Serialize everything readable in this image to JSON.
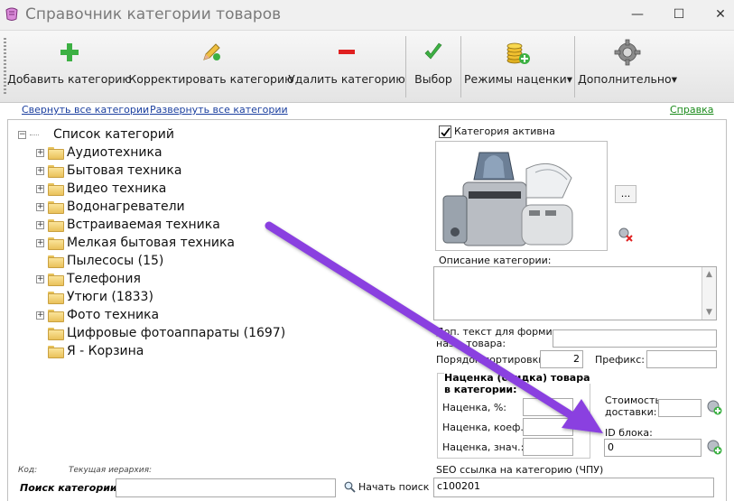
{
  "window": {
    "title": "Справочник категории товаров",
    "minimize_glyph": "—",
    "maximize_glyph": "☐",
    "close_glyph": "✕"
  },
  "toolbar": {
    "add_label": "Добавить категорию",
    "edit_label": "Корректировать категорию",
    "delete_label": "Удалить категорию",
    "select_label": "Выбор",
    "markup_modes_label": "Режимы наценки",
    "more_label": "Дополнительно",
    "dropdown_glyph": "▾"
  },
  "links": {
    "collapse_all": "Свернуть все категории",
    "expand_all": "Развернуть все категории",
    "help": "Справка"
  },
  "tree": {
    "root_label": "Список категорий",
    "items": [
      {
        "label": "Аудиотехника",
        "expandable": true
      },
      {
        "label": "Бытовая техника",
        "expandable": true
      },
      {
        "label": "Видео техника",
        "expandable": true
      },
      {
        "label": "Водонагреватели",
        "expandable": true
      },
      {
        "label": "Встраиваемая техника",
        "expandable": true
      },
      {
        "label": "Мелкая бытовая техника",
        "expandable": true
      },
      {
        "label": "Пылесосы (15)",
        "expandable": false
      },
      {
        "label": "Телефония",
        "expandable": true
      },
      {
        "label": "Утюги (1833)",
        "expandable": false
      },
      {
        "label": "Фото техника",
        "expandable": true
      },
      {
        "label": "Цифровые фотоаппараты (1697)",
        "expandable": false
      },
      {
        "label": "Я - Корзина",
        "expandable": false
      }
    ]
  },
  "details": {
    "active_label": "Категория активна",
    "browse_button": "...",
    "description_label": "Описание категории:",
    "extra_text_label_1": "Доп. текст для формир.",
    "extra_text_label_2": "назв. товара:",
    "sort_order_label": "Порядок сортировки:",
    "sort_order_value": "2",
    "prefix_label": "Префикс:",
    "markup_group_title_1": "Наценка (скидка) товара",
    "markup_group_title_2": "в категории:",
    "markup_percent_label": "Наценка, %:",
    "markup_coef_label": "Наценка, коеф.:",
    "markup_value_label": "Наценка, знач.:",
    "delivery_label_1": "Стоимость",
    "delivery_label_2": "доставки:",
    "block_id_label": "ID блока:",
    "block_id_value": "0",
    "seo_label": "SEO ссылка на категорию (ЧПУ)",
    "seo_value": "c100201"
  },
  "footer": {
    "code_label": "Код:",
    "hierarchy_label": "Текущая иерархия:",
    "search_label": "Поиск категории:",
    "search_button": "Начать поиск"
  },
  "colors": {
    "arrow": "#8a3fe0",
    "link": "#1b3f9f",
    "help_link": "#1a8a1a",
    "add_green": "#3cb043",
    "delete_red": "#e02020"
  }
}
